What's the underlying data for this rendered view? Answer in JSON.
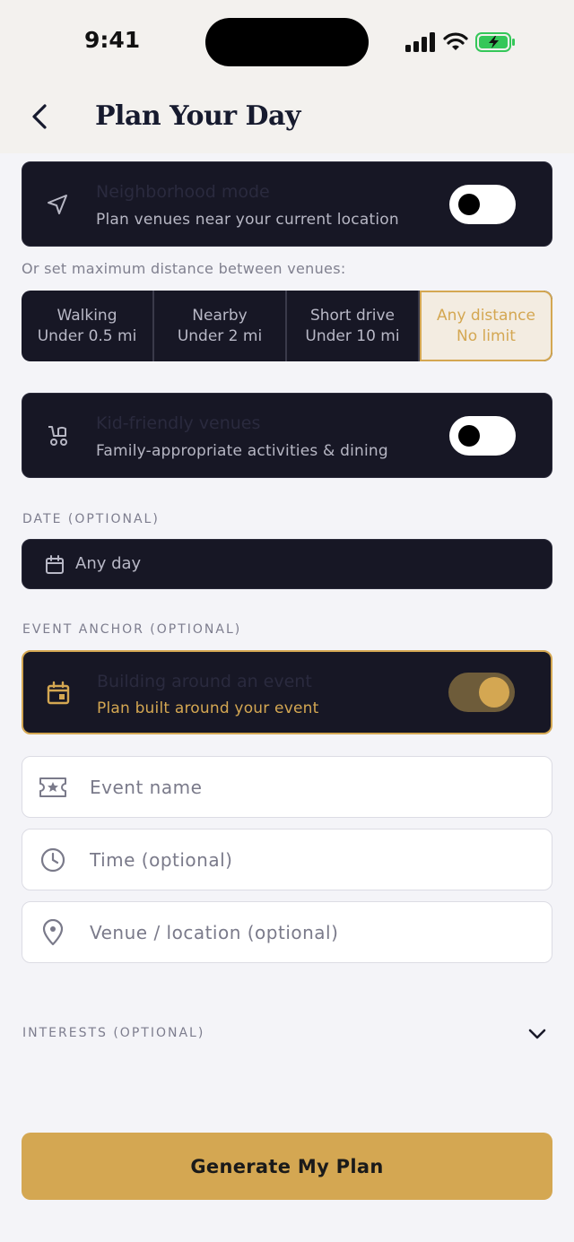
{
  "status_bar": {
    "time": "9:41"
  },
  "header": {
    "title": "Plan Your Day"
  },
  "neighborhood": {
    "title": "Neighborhood mode",
    "subtitle": "Plan venues near your current location",
    "enabled": false
  },
  "distance": {
    "hint": "Or set maximum distance between venues:",
    "options": [
      {
        "label": "Walking",
        "sub": "Under 0.5 mi"
      },
      {
        "label": "Nearby",
        "sub": "Under 2 mi"
      },
      {
        "label": "Short drive",
        "sub": "Under 10 mi"
      },
      {
        "label": "Any distance",
        "sub": "No limit"
      }
    ],
    "selected": "Any distance"
  },
  "kid_friendly": {
    "title": "Kid-friendly venues",
    "subtitle": "Family-appropriate activities & dining",
    "enabled": false
  },
  "date": {
    "label": "DATE (OPTIONAL)",
    "value": "Any day"
  },
  "event_anchor": {
    "label": "EVENT ANCHOR (OPTIONAL)",
    "title": "Building around an event",
    "subtitle": "Plan built around your event",
    "enabled": true
  },
  "event_fields": {
    "name_placeholder": "Event name",
    "time_placeholder": "Time (optional)",
    "venue_placeholder": "Venue / location (optional)"
  },
  "interests": {
    "label": "INTERESTS (OPTIONAL)"
  },
  "cta": {
    "label": "Generate My Plan"
  },
  "colors": {
    "accent": "#d4a752",
    "dark_card": "#171725",
    "background": "#f4f4f8"
  }
}
